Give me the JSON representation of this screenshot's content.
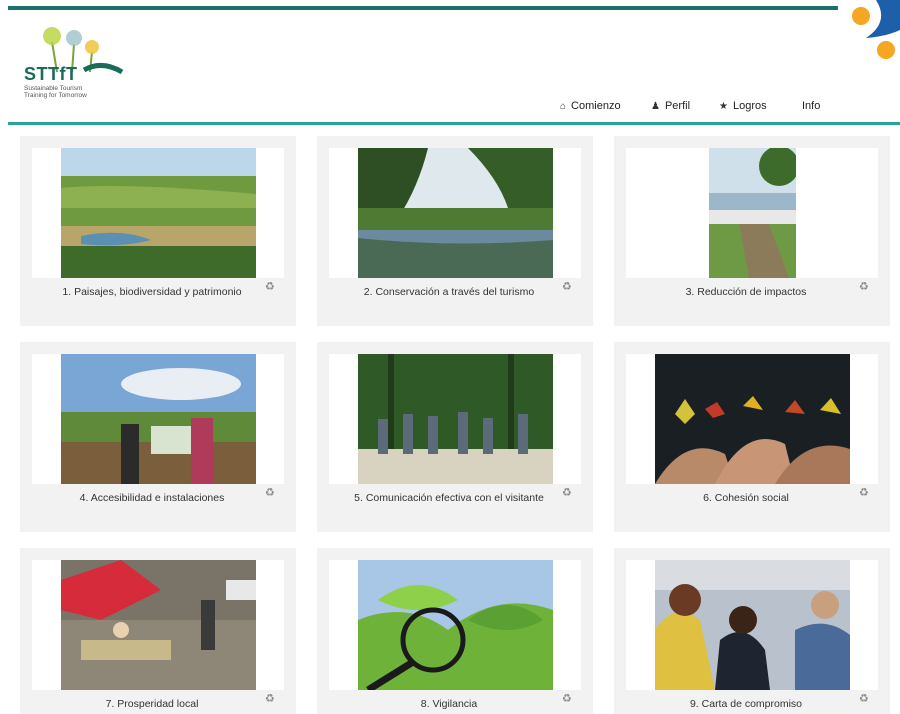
{
  "brand": {
    "name": "STTfT",
    "tagline_1": "Sustainable Tourism",
    "tagline_2": "Training for Tomorrow"
  },
  "nav": [
    {
      "label": "Comienzo",
      "icon": "home-icon"
    },
    {
      "label": "Perfil",
      "icon": "user-icon"
    },
    {
      "label": "Logros",
      "icon": "star-icon"
    },
    {
      "label": "Info",
      "icon": ""
    }
  ],
  "modules": [
    {
      "title": "1. Paisajes, biodiversidad y patrimonio",
      "image": "vineyard-landscape"
    },
    {
      "title": "2. Conservación a través del turismo",
      "image": "forest-river"
    },
    {
      "title": "3. Reducción de impactos",
      "image": "marina-walkway"
    },
    {
      "title": "4. Accesibilidad e instalaciones",
      "image": "viewpoint-visitors"
    },
    {
      "title": "5. Comunicación efectiva con el visitante",
      "image": "guided-group-forest"
    },
    {
      "title": "6. Cohesión social",
      "image": "hands-autumn-leaves"
    },
    {
      "title": "7. Prosperidad local",
      "image": "market-stall"
    },
    {
      "title": "8. Vigilancia",
      "image": "magnifier-leaves"
    },
    {
      "title": "9. Carta de compromiso",
      "image": "conference-people"
    }
  ],
  "colors": {
    "teal_line": "#2aa39a",
    "dark_line": "#1f6f6c",
    "card_bg": "#f2f2f2",
    "logo_green": "#1b6b59",
    "accent_orange": "#f5a623",
    "accent_blue": "#1d5fa8"
  }
}
